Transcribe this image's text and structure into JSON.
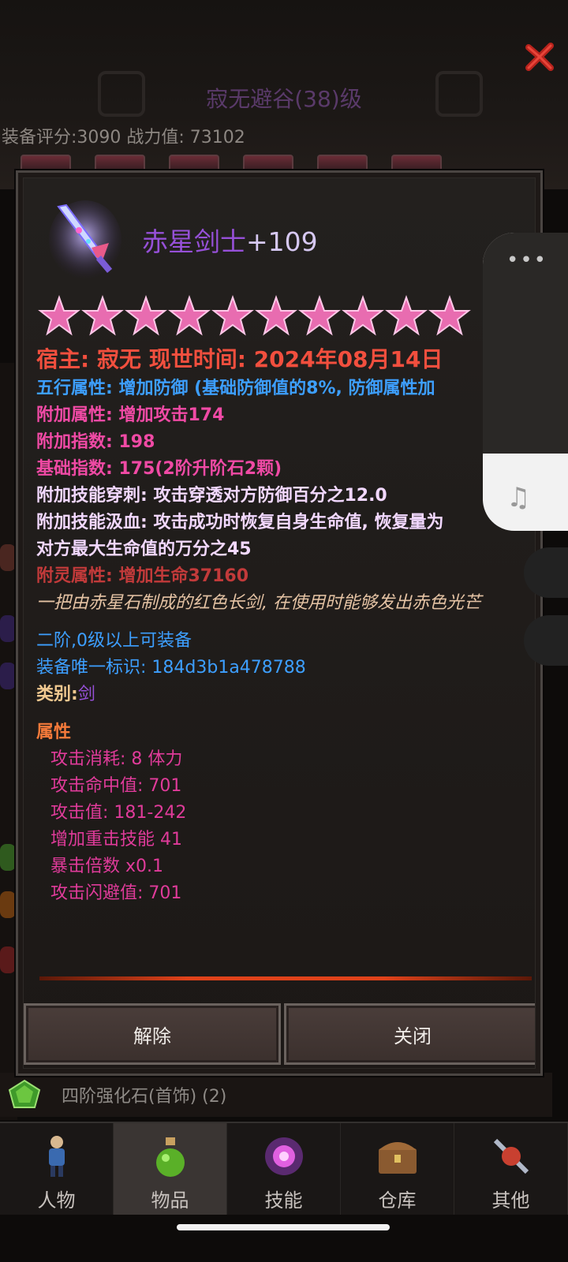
{
  "header": {
    "title": "寂无避谷(38)级",
    "score_line": "装备评分:3090 战力值: 73102"
  },
  "item": {
    "name": "赤星剑士",
    "enhance": "+109",
    "stars": 10,
    "host_line": "宿主: 寂无 现世时间: 2024年08月14日",
    "five_elements": "五行属性: 增加防御 (基础防御值的8%, 防御属性加",
    "extra_attr": "附加属性: 增加攻击174",
    "extra_index": "附加指数: 198",
    "base_index": "基础指数: 175(2阶升阶石2颗)",
    "skill_pierce": "附加技能穿刺: 攻击穿透对方防御百分之12.0",
    "skill_leech_1": "附加技能汲血: 攻击成功时恢复自身生命值, 恢复量为",
    "skill_leech_2": "对方最大生命值的万分之45",
    "spirit_attr": "附灵属性: 增加生命37160",
    "description": "一把由赤星石制成的红色长剑, 在使用时能够发出赤色光芒",
    "requirement": "二阶,0级以上可装备",
    "unique_id": "装备唯一标识: 184d3b1a478788",
    "category_label": "类别:",
    "category_value": "剑",
    "attr_title": "属性",
    "attributes": [
      "攻击消耗: 8 体力",
      "攻击命中值: 701",
      "攻击值: 181-242",
      "增加重击技能 41",
      "暴击倍数 x0.1",
      "攻击闪避值: 701"
    ]
  },
  "buttons": {
    "unequip": "解除",
    "close": "关闭"
  },
  "background_item": "四阶强化石(首饰) (2)",
  "side_widget": {
    "more": "•••",
    "music_icon": "music-note-icon"
  },
  "tabs": [
    {
      "label": "人物",
      "icon": "character-icon"
    },
    {
      "label": "物品",
      "icon": "potion-icon"
    },
    {
      "label": "技能",
      "icon": "skill-orb-icon"
    },
    {
      "label": "仓库",
      "icon": "chest-icon"
    },
    {
      "label": "其他",
      "icon": "other-icon"
    }
  ],
  "colors": {
    "name": "#9650d8",
    "host": "#f24f3e",
    "blue": "#3d9fff",
    "pink": "#f04aa5",
    "star": "#e86cb0"
  }
}
